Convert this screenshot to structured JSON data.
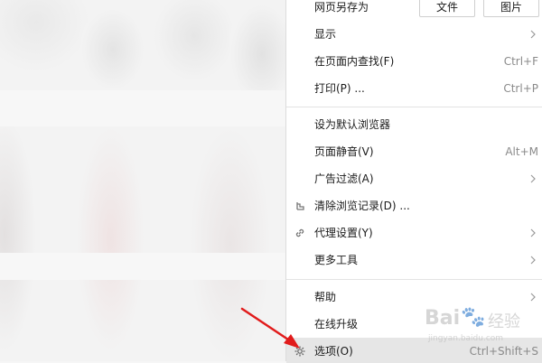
{
  "menu": {
    "save_as": {
      "label": "网页另存为",
      "btn_file": "文件",
      "btn_image": "图片"
    },
    "items": [
      {
        "label": "显示",
        "shortcut": "",
        "submenu": true
      },
      {
        "label": "在页面内查找(F)",
        "shortcut": "Ctrl+F",
        "submenu": false
      },
      {
        "label": "打印(P) ...",
        "shortcut": "Ctrl+P",
        "submenu": false
      },
      {
        "label": "设为默认浏览器",
        "shortcut": "",
        "submenu": false
      },
      {
        "label": "页面静音(V)",
        "shortcut": "Alt+M",
        "submenu": false
      },
      {
        "label": "广告过滤(A)",
        "shortcut": "",
        "submenu": true
      },
      {
        "label": "清除浏览记录(D) ...",
        "shortcut": "",
        "submenu": false,
        "icon": "broom-icon"
      },
      {
        "label": "代理设置(Y)",
        "shortcut": "",
        "submenu": true,
        "icon": "link-icon"
      },
      {
        "label": "更多工具",
        "shortcut": "",
        "submenu": true
      },
      {
        "label": "帮助",
        "shortcut": "",
        "submenu": true
      },
      {
        "label": "在线升级",
        "shortcut": "",
        "submenu": false
      },
      {
        "label": "选项(O)",
        "shortcut": "Ctrl+Shift+S",
        "submenu": false,
        "icon": "gear-icon",
        "highlighted": true
      }
    ]
  },
  "watermark": {
    "brand": "Bai",
    "brand_cn": "经验",
    "url": "jingyan.baidu.com"
  },
  "colors": {
    "annotation_arrow": "#e11b1b",
    "highlight": "#e6e6e6"
  }
}
